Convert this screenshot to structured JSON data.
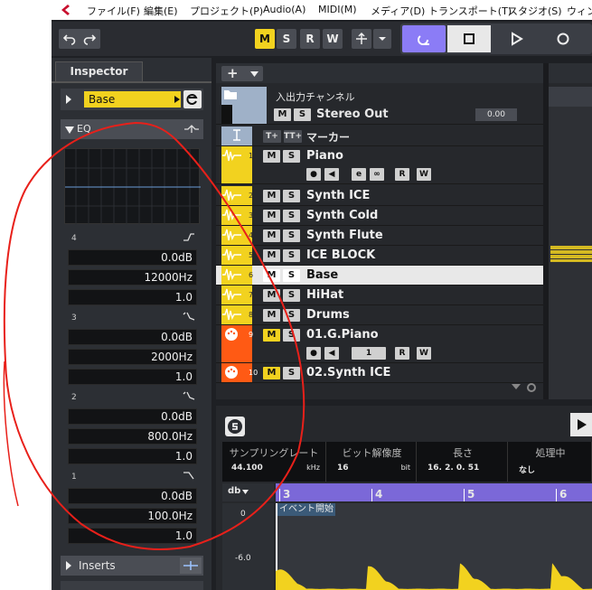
{
  "menubar": {
    "items": [
      "ファイル(F)",
      "編集(E)",
      "プロジェクト(P)",
      "Audio(A)",
      "MIDI(M)",
      "メディア(D)",
      "トランスポート(T)",
      "スタジオ(S)",
      "ウィンドウ"
    ]
  },
  "toolbar": {
    "undo_icon": "undo-icon",
    "redo_icon": "redo-icon",
    "m_label": "M",
    "s_label": "S",
    "r_label": "R",
    "w_label": "W"
  },
  "inspector": {
    "tab_label": "Inspector",
    "track_name": "Base",
    "eq_label": "EQ",
    "bands": [
      {
        "num": "4",
        "gain": "0.0dB",
        "freq": "12000Hz",
        "q": "1.0"
      },
      {
        "num": "3",
        "gain": "0.0dB",
        "freq": "2000Hz",
        "q": "1.0"
      },
      {
        "num": "2",
        "gain": "0.0dB",
        "freq": "800.0Hz",
        "q": "1.0"
      },
      {
        "num": "1",
        "gain": "0.0dB",
        "freq": "100.0Hz",
        "q": "1.0"
      }
    ],
    "inserts_label": "Inserts"
  },
  "tracklist": {
    "add_label": "+",
    "io_channel_label": "入出力チャンネル",
    "stereo_out": {
      "name": "Stereo Out",
      "value": "0.00"
    },
    "marker_label": "マーカー",
    "tracks": [
      {
        "num": "1",
        "name": "Piano"
      },
      {
        "num": "2",
        "name": "Synth ICE"
      },
      {
        "num": "3",
        "name": "Synth Cold"
      },
      {
        "num": "4",
        "name": "Synth Flute"
      },
      {
        "num": "5",
        "name": "ICE BLOCK"
      },
      {
        "num": "6",
        "name": "Base"
      },
      {
        "num": "7",
        "name": "HiHat"
      },
      {
        "num": "8",
        "name": "Drums"
      },
      {
        "num": "9",
        "name": "01.G.Piano"
      },
      {
        "num": "10",
        "name": "02.Synth ICE"
      }
    ],
    "midi_port": "1",
    "ms_m": "M",
    "ms_s": "S",
    "read_label": "R",
    "write_label": "W"
  },
  "editor": {
    "columns": [
      {
        "header": "サンプリングレート",
        "value": "44.100",
        "unit": "kHz"
      },
      {
        "header": "ビット解像度",
        "value": "16",
        "unit": "bit"
      },
      {
        "header": "長さ",
        "value": "16. 2. 0. 51",
        "unit": ""
      },
      {
        "header": "処理中",
        "value": "なし",
        "unit": ""
      }
    ],
    "db_label": "db",
    "ruler": [
      "3",
      "4",
      "5",
      "6"
    ],
    "event_start": "イベント開始",
    "db_scale": [
      "0",
      "-6.0"
    ]
  },
  "colors": {
    "track_yellow": "#f2d21f",
    "midi_orange": "#ff5a14",
    "accent_purple": "#8b7cf6",
    "annotation_red": "#e8201a"
  }
}
